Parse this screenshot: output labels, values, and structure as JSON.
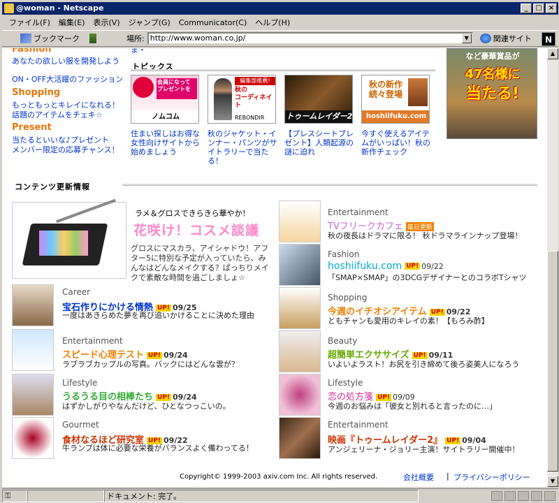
{
  "window": {
    "title": "@woman - Netscape"
  },
  "menu": [
    "ファイル(F)",
    "編集(E)",
    "表示(V)",
    "ジャンプ(G)",
    "Communicator(C)",
    "ヘルプ(H)"
  ],
  "toolbar": {
    "bookmark": "ブックマーク",
    "location_label": "場所:",
    "url": "http://www.woman.co.jp/",
    "related": "関連サイト"
  },
  "left_nav": {
    "fashion_head": "Fashion",
    "fashion_l1": "あなたの欲しい服を開発しよう",
    "fashion_l2": "ON・OFF大活躍のファッション",
    "shopping_head": "Shopping",
    "shopping_l1": "もっともっとキレイになれる！",
    "shopping_l2": "話題のアイテムをチェキ☆",
    "present_head": "Present",
    "present_l1": "当たるといいな♪プレゼント",
    "present_l2": "メンバー限定の応募チャンス！",
    "cut_line": "ま・"
  },
  "topics": {
    "title": "トピックス",
    "items": [
      {
        "img": "会員になってプレゼントをGET!デジカメ他 女性のための住みかえサイト ノムコム・ウーマン",
        "text": "住まい探しはお得な女性向けサイトから始めましょう"
      },
      {
        "img": "編集部推薦! 秋のコーディネイトプレゼント! REBONDIR",
        "text": "秋のジャケット・インナー・パンツがサイトラリーで当たる！"
      },
      {
        "img": "トゥームレイダー2",
        "text": "【プレスシートプレゼント】人類起源の謎に迫れ"
      },
      {
        "img": "秋の新作続々登場 hoshiifuku.com",
        "text": "今すぐ使えるアイテムがいっぱい！秋の新作チェック"
      }
    ]
  },
  "ad": {
    "line1": "など豪華賞品が",
    "line2": "47名様に",
    "line3": "当たる!"
  },
  "updates": {
    "title": "コンテンツ更新情報",
    "feature": {
      "tagline": "ラメ＆グロスできらきら華やか！",
      "headline": "花咲け！コスメ談議",
      "desc": "グロスにマスカラ、アイシャドウ！アフター5に特別な予定が入っていたら、みんなはどんなメイクする？ぱっちりメイクで素敵な時間を過ごしましょ☆"
    },
    "up_label": "UP!",
    "left": [
      {
        "cat": "Career",
        "title": "宝石作りにかける情熱",
        "date": "09/25",
        "desc": "一度はあきらめた夢を再び追いかけることに決めた理由",
        "color": "#0033cc"
      },
      {
        "cat": "Entertainment",
        "title": "スピード心理テスト",
        "date": "09/24",
        "desc": "ラブラブカップルの写真。バックにはどんな雲が？",
        "color": "#f08000"
      },
      {
        "cat": "Lifestyle",
        "title": "うるうる目の相棒たち",
        "date": "09/24",
        "desc": "はずかしがりやなんだけど、ひとなつっこいの。",
        "color": "#33aa33"
      },
      {
        "cat": "Gourmet",
        "title": "食材なるほど研究室",
        "date": "09/22",
        "desc": "牛ランプは体に必要な栄養がバランスよく備わってる！",
        "color": "#cc3300"
      }
    ],
    "right": [
      {
        "cat": "Entertainment",
        "title": "TVフリークカフェ",
        "badge": "毎日更新",
        "desc": "秋の夜長はドラマに限る！ 秋ドラマラインナップ登場！",
        "color": "#cc66cc"
      },
      {
        "cat": "Fashion",
        "title": "hoshiifuku.com",
        "date": "09/22",
        "desc": "「SMAP×SMAP」の3DCGデザイナーとのコラボTシャツ",
        "color": "#00aacc"
      },
      {
        "cat": "Shopping",
        "title": "今週のイチオシアイテム",
        "date": "09/22",
        "desc": "ともチャンも愛用のキレイの素！【もろみ酢】",
        "color": "#f08000"
      },
      {
        "cat": "Beauty",
        "title": "超簡単エクササイズ",
        "date": "09/11",
        "desc": "いよいよラスト！お尻を引き締めて後ろ姿美人になろう",
        "color": "#66aa00"
      },
      {
        "cat": "Lifestyle",
        "title": "恋の処方箋",
        "date": "09/09",
        "desc": "今週のお悩みは「彼女と別れると言ったのに…」",
        "color": "#cc3399"
      },
      {
        "cat": "Entertainment",
        "title": "映画『トゥームレイダー2』",
        "date": "09/04",
        "desc": "アンジェリーナ・ジョリー主演！サイトラリー開催中！",
        "color": "#cc3300"
      }
    ]
  },
  "footer": {
    "copyright": "Copyright© 1999-2003 axiv.com Inc. All rights reserved.",
    "company": "会社概要",
    "sep": "|",
    "privacy": "プライバシーポリシー"
  },
  "status": {
    "text": "ドキュメント: 完了。"
  }
}
